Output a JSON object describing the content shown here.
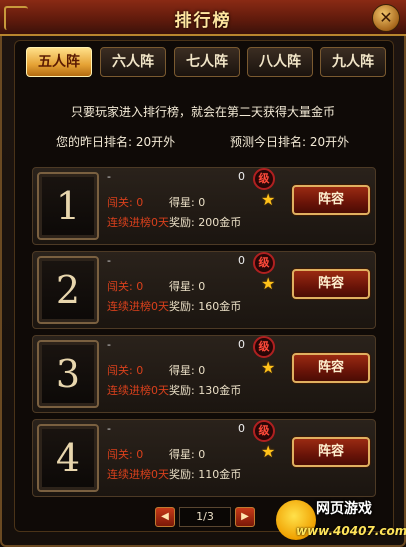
{
  "window": {
    "title": "排行榜",
    "close_glyph": "✕"
  },
  "tabs": [
    {
      "label": "五人阵",
      "active": true
    },
    {
      "label": "六人阵",
      "active": false
    },
    {
      "label": "七人阵",
      "active": false
    },
    {
      "label": "八人阵",
      "active": false
    },
    {
      "label": "九人阵",
      "active": false
    }
  ],
  "info": {
    "notice": "只要玩家进入排行榜，就会在第二天获得大量金币",
    "yesterday_rank": "您的昨日排名: 20开外",
    "today_rank": "预测今日排名: 20开外"
  },
  "entries": [
    {
      "rank": "1",
      "name": "-",
      "level": "0",
      "level_badge": "级",
      "stage": "闯关: 0",
      "streak": "连续进榜0天",
      "stars": "得星: 0",
      "reward": "奖励: 200金币",
      "button": "阵容"
    },
    {
      "rank": "2",
      "name": "-",
      "level": "0",
      "level_badge": "级",
      "stage": "闯关: 0",
      "streak": "连续进榜0天",
      "stars": "得星: 0",
      "reward": "奖励: 160金币",
      "button": "阵容"
    },
    {
      "rank": "3",
      "name": "-",
      "level": "0",
      "level_badge": "级",
      "stage": "闯关: 0",
      "streak": "连续进榜0天",
      "stars": "得星: 0",
      "reward": "奖励: 130金币",
      "button": "阵容"
    },
    {
      "rank": "4",
      "name": "-",
      "level": "0",
      "level_badge": "级",
      "stage": "闯关: 0",
      "streak": "连续进榜0天",
      "stars": "得星: 0",
      "reward": "奖励: 110金币",
      "button": "阵容"
    }
  ],
  "pager": {
    "prev": "◀",
    "next": "▶",
    "indicator": "1/3"
  },
  "watermark": {
    "title": "网页游戏",
    "url": "www.40407.com"
  },
  "colors": {
    "accent": "#e5a235",
    "title_bar": "#5e1a0c",
    "highlight_text": "#d8401c"
  }
}
